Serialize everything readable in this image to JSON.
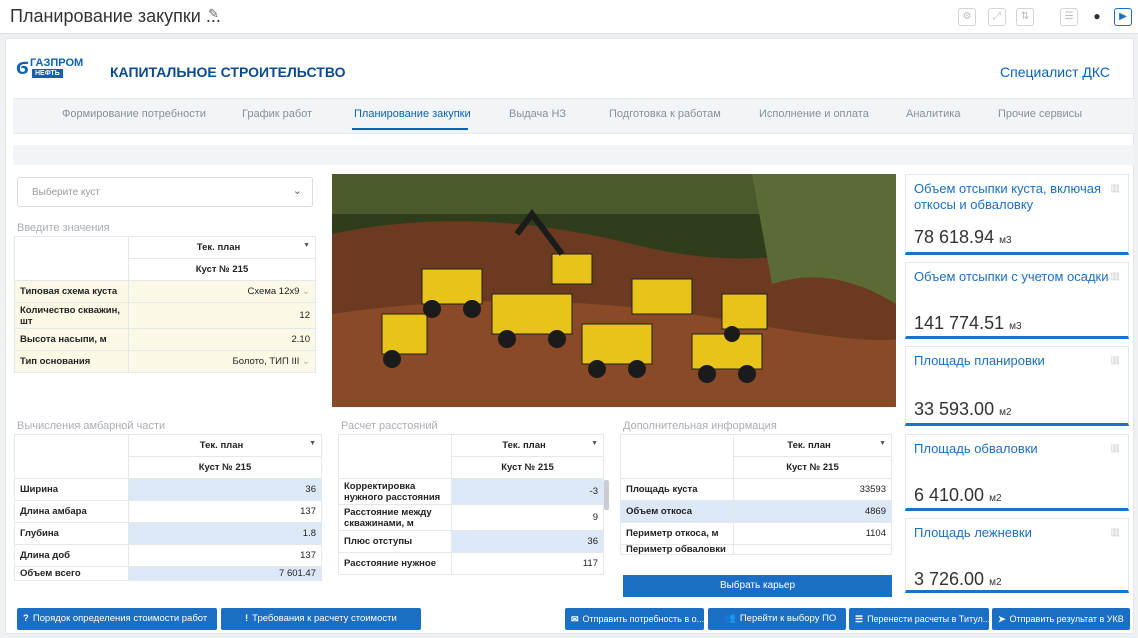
{
  "title": "Планирование закупки ...",
  "header": {
    "brand_top": "ГАЗПРОМ",
    "brand_bottom": "НЕФТЬ",
    "app_name": "КАПИТАЛЬНОЕ СТРОИТЕЛЬСТВО",
    "role": "Специалист ДКС"
  },
  "nav": [
    "Формирование потребности",
    "График работ",
    "Планирование закупки",
    "Выдача НЗ",
    "Подготовка к работам",
    "Исполнение и оплата",
    "Аналитика",
    "Прочие сервисы"
  ],
  "select": {
    "placeholder": "Выберите куст"
  },
  "inputs": {
    "label": "Введите значения",
    "col_header": "Тек. план",
    "sub_header": "Куст № 215",
    "rows": [
      {
        "label": "Типовая схема куста",
        "value": "Схема 12x9"
      },
      {
        "label": "Количество скважин, шт",
        "value": "12"
      },
      {
        "label": "Высота насыпи, м",
        "value": "2.10"
      },
      {
        "label": "Тип основания",
        "value": "Болото, ТИП III"
      }
    ]
  },
  "calc": {
    "label": "Вычисления амбарной части",
    "col_header": "Тек. план",
    "sub_header": "Куст № 215",
    "rows": [
      {
        "label": "Ширина",
        "value": "36"
      },
      {
        "label": "Длина амбара",
        "value": "137"
      },
      {
        "label": "Глубина",
        "value": "1.8"
      },
      {
        "label": "Длина доб",
        "value": "137"
      },
      {
        "label": "Объем всего",
        "value": "7 601.47"
      }
    ]
  },
  "dist": {
    "label": "Расчет расстояний",
    "col_header": "Тек. план",
    "sub_header": "Куст № 215",
    "rows": [
      {
        "label": "Корректировка нужного расстояния",
        "value": "-3"
      },
      {
        "label": "Расстояние между скважинами, м",
        "value": "9"
      },
      {
        "label": "Плюс отступы",
        "value": "36"
      },
      {
        "label": "Расстояние нужное",
        "value": "117"
      }
    ]
  },
  "extra": {
    "label": "Дополнительная информация",
    "col_header": "Тек. план",
    "sub_header": "Куст № 215",
    "rows": [
      {
        "label": "Площадь куста",
        "value": "33593"
      },
      {
        "label": "Объем откоса",
        "value": "4869"
      },
      {
        "label": "Периметр откоса, м",
        "value": "1104"
      },
      {
        "label": "Периметр обваловки",
        "value": ""
      }
    ],
    "button": "Выбрать карьер"
  },
  "kpis": [
    {
      "title": "Объем отсыпки куста, включая откосы и обваловку",
      "value": "78 618.94",
      "unit": "м3"
    },
    {
      "title": "Объем отсыпки с учетом осадки",
      "value": "141 774.51",
      "unit": "м3"
    },
    {
      "title": "Площадь планировки",
      "value": "33 593.00",
      "unit": "м2"
    },
    {
      "title": "Площадь обваловки",
      "value": "6 410.00",
      "unit": "м2"
    },
    {
      "title": "Площадь лежневки",
      "value": "3 726.00",
      "unit": "м2"
    }
  ],
  "buttons": [
    "Порядок определения стоимости работ",
    "Требования к расчету стоимости",
    "Отправить потребность в о...",
    "Перейти к выбору ПО",
    "Перенести расчеты в Титул...",
    "Отправить результат в УКВ"
  ],
  "colors": {
    "accent": "#1a6fc4",
    "brand": "#0b4a8c",
    "input_row": "#fbf9e6",
    "highlight_row": "#dde8f7"
  }
}
